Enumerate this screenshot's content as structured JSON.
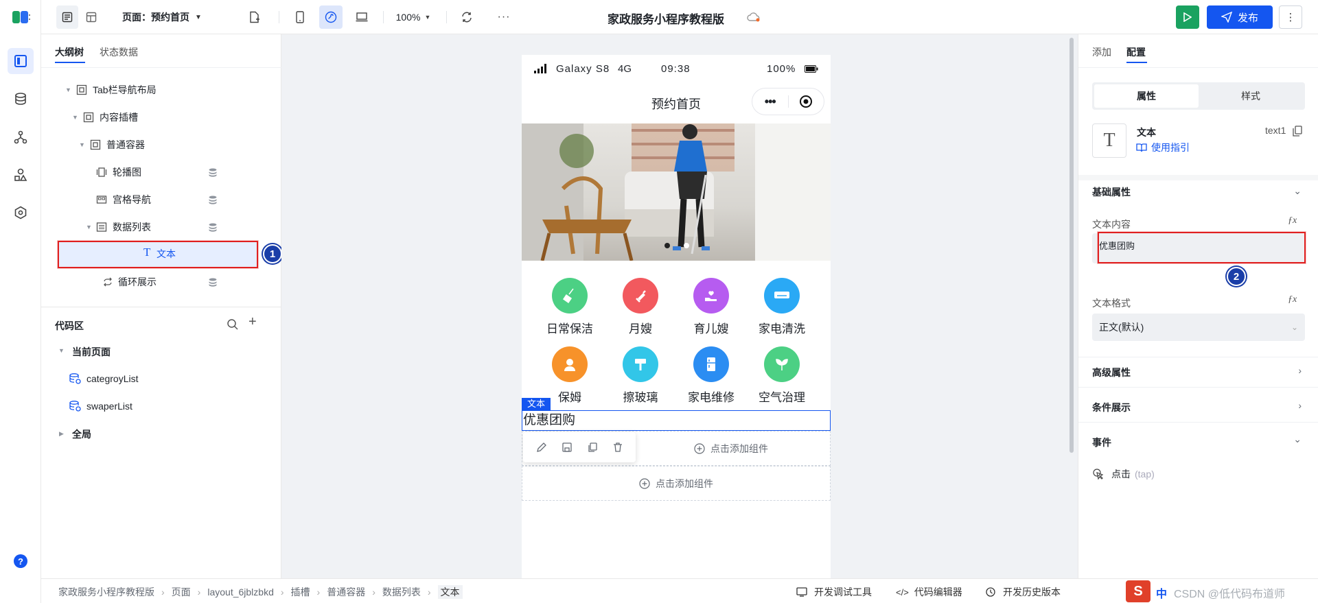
{
  "topbar": {
    "page_label": "页面：预约首页",
    "zoom": "100%",
    "app_title": "家政服务小程序教程版",
    "publish_label": "发布"
  },
  "left": {
    "tabs": [
      "大纲树",
      "状态数据"
    ],
    "tree": [
      {
        "label": "Tab栏导航布局"
      },
      {
        "label": "内容插槽"
      },
      {
        "label": "普通容器"
      },
      {
        "label": "轮播图"
      },
      {
        "label": "宫格导航"
      },
      {
        "label": "数据列表"
      },
      {
        "label": "文本"
      },
      {
        "label": "循环展示"
      }
    ],
    "badge1": "1",
    "code_title": "代码区",
    "current_page": "当前页面",
    "code_items": [
      "categroyList",
      "swaperList"
    ],
    "global": "全局"
  },
  "phone": {
    "status": {
      "device": "Galaxy S8",
      "network": "4G",
      "time": "09:38",
      "battery": "100%"
    },
    "nav_title": "预约首页",
    "grid": [
      {
        "label": "日常保洁",
        "color": "#4cd084"
      },
      {
        "label": "月嫂",
        "color": "#f2595e"
      },
      {
        "label": "育儿嫂",
        "color": "#b65cf0"
      },
      {
        "label": "家电清洗",
        "color": "#2aa9f5"
      },
      {
        "label": "保姆",
        "color": "#f7922a"
      },
      {
        "label": "擦玻璃",
        "color": "#32c6e8"
      },
      {
        "label": "家电维修",
        "color": "#2b8df2"
      },
      {
        "label": "空气治理",
        "color": "#4cd084"
      }
    ],
    "sel_tag": "文本",
    "text_content": "优惠团购",
    "add_component": "点击添加组件"
  },
  "right": {
    "tabs": [
      "添加",
      "配置"
    ],
    "seg": [
      "属性",
      "样式"
    ],
    "component_name": "文本",
    "component_id": "text1",
    "guide_link": "使用指引",
    "basic_props": "基础属性",
    "text_content_label": "文本内容",
    "text_value": "优惠团购",
    "badge2": "2",
    "text_format_label": "文本格式",
    "text_format_value": "正文(默认)",
    "advanced": "高级属性",
    "condition": "条件展示",
    "events": "事件",
    "event_item": "点击",
    "event_hint": "(tap)"
  },
  "footer": {
    "crumbs": [
      "家政服务小程序教程版",
      "页面",
      "layout_6jblzbkd",
      "插槽",
      "普通容器",
      "数据列表",
      "文本"
    ],
    "tools": [
      "开发调试工具",
      "代码编辑器",
      "开发历史版本"
    ],
    "ime": "中",
    "watermark": "CSDN @低代码布道师"
  }
}
